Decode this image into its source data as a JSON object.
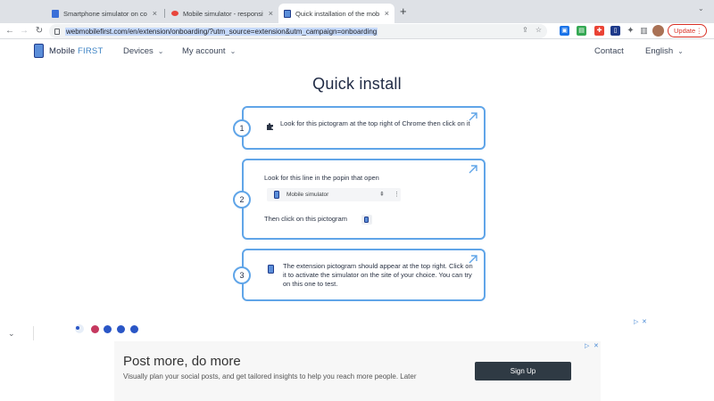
{
  "browser": {
    "tabs": [
      {
        "title": "Smartphone simulator on com",
        "close": "×"
      },
      {
        "title": "Mobile simulator - responsiv",
        "close": "×"
      },
      {
        "title": "Quick installation of the mobil",
        "close": "×"
      }
    ],
    "new_tab": "+",
    "url": "webmobilefirst.com/en/extension/onboarding/?utm_source=extension&utm_campaign=onboarding",
    "update_label": "Update",
    "update_menu": "⋮"
  },
  "site": {
    "logo_main": "Mobile ",
    "logo_accent": "FIRST",
    "nav": {
      "devices": "Devices",
      "account": "My account",
      "contact": "Contact",
      "language": "English"
    }
  },
  "main": {
    "title": "Quick install",
    "steps": [
      {
        "number": "1",
        "text": "Look for this pictogram at the top right of Chrome then click on it"
      },
      {
        "number": "2",
        "line1": "Look for this line in the popin that open",
        "popup_item": "Mobile simulator",
        "line2": "Then click on this pictogram"
      },
      {
        "number": "3",
        "text": "The extension pictogram should appear at the top right. Click on it to activate the simulator on the site of your choice. You can try on this one to test."
      }
    ]
  },
  "ad": {
    "title": "Post more, do more",
    "description": "Visually plan your social posts, and get tailored insights to help you reach more people. Later",
    "cta": "Sign Up"
  },
  "colors": {
    "accent": "#60a5e8",
    "brand_dark": "#1e3a8a",
    "update_red": "#d93025"
  }
}
